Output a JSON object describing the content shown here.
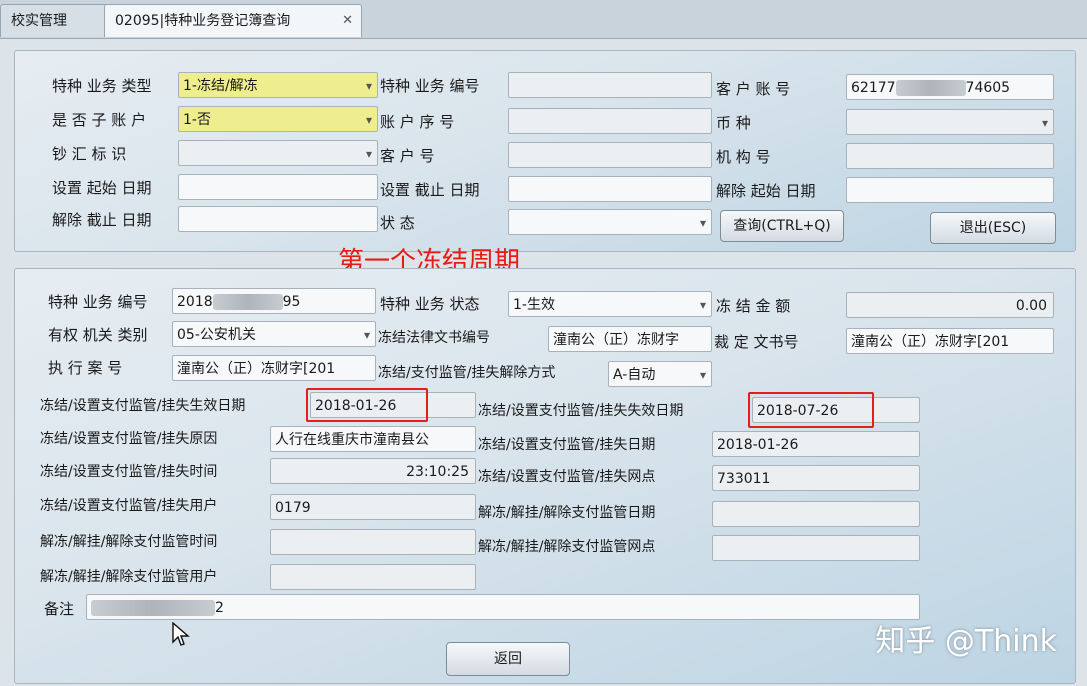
{
  "tabs": {
    "prev": "校实管理",
    "active": "02095|特种业务登记簿查询",
    "close_glyph": "✕"
  },
  "query": {
    "biz_type_label": "特种 业务 类型",
    "biz_type_value": "1-冻结/解冻",
    "biz_no_label": "特种 业务 编号",
    "biz_no_value": "",
    "cust_account_label": "客 户 账 号",
    "cust_account_prefix": "62177",
    "cust_account_suffix": "74605",
    "sub_account_label": "是 否 子 账 户",
    "sub_account_value": "1-否",
    "acct_seq_label": "账 户 序 号",
    "acct_seq_value": "",
    "currency_label": "币 种",
    "currency_value": "",
    "cash_flag_label": "钞 汇 标 识",
    "cash_flag_value": "",
    "cust_no_label": "客 户 号",
    "cust_no_value": "",
    "org_label": "机 构 号",
    "org_value": "",
    "set_start_label": "设置 起始 日期",
    "set_start_value": "",
    "set_end_label": "设置 截止 日期",
    "set_end_value": "",
    "rel_start_label": "解除 起始 日期",
    "rel_start_value": "",
    "rel_end_label": "解除 截止 日期",
    "rel_end_value": "",
    "status_label": "状 态",
    "status_value": "",
    "query_btn": "查询(CTRL+Q)",
    "exit_btn": "退出(ESC)"
  },
  "annotation": "第一个冻结周期",
  "detail": {
    "biz_no_label": "特种 业务 编号",
    "biz_no_prefix": "2018",
    "biz_no_suffix": "95",
    "biz_status_label": "特种 业务 状态",
    "biz_status_value": "1-生效",
    "freeze_amt_label": "冻 结 金 额",
    "freeze_amt_value": "0.00",
    "authority_type_label": "有权 机关 类别",
    "authority_type_value": "05-公安机关",
    "legal_doc_label": "冻结法律文书编号",
    "legal_doc_value": "潼南公（正）冻财字",
    "ruling_doc_label": "裁 定 文书号",
    "ruling_doc_value": "潼南公（正）冻财字[201",
    "case_no_label": "执 行 案 号",
    "case_no_value": "潼南公（正）冻财字[201",
    "release_mode_label": "冻结/支付监管/挂失解除方式",
    "release_mode_value": "A-自动",
    "eff_date_label": "冻结/设置支付监管/挂失生效日期",
    "eff_date_value": "2018-01-26",
    "exp_date_label": "冻结/设置支付监管/挂失失效日期",
    "exp_date_value": "2018-07-26",
    "reason_label": "冻结/设置支付监管/挂失原因",
    "reason_value": "人行在线重庆市潼南县公",
    "op_date_label": "冻结/设置支付监管/挂失日期",
    "op_date_value": "2018-01-26",
    "op_time_label": "冻结/设置支付监管/挂失时间",
    "op_time_value": "23:10:25",
    "branch_label": "冻结/设置支付监管/挂失网点",
    "branch_value": "733011",
    "user_label": "冻结/设置支付监管/挂失用户",
    "user_value": "0179",
    "unfreeze_date_label": "解冻/解挂/解除支付监管日期",
    "unfreeze_date_value": "",
    "unfreeze_time_label": "解冻/解挂/解除支付监管时间",
    "unfreeze_time_value": "",
    "unfreeze_branch_label": "解冻/解挂/解除支付监管网点",
    "unfreeze_branch_value": "",
    "unfreeze_user_label": "解冻/解挂/解除支付监管用户",
    "unfreeze_user_value": "",
    "remark_label": "备注",
    "remark_suffix": "2",
    "back_btn": "返回"
  },
  "watermark": "知乎 @Think",
  "colors": {
    "highlight": "#e0211a",
    "yellow_field": "#efee8f"
  }
}
